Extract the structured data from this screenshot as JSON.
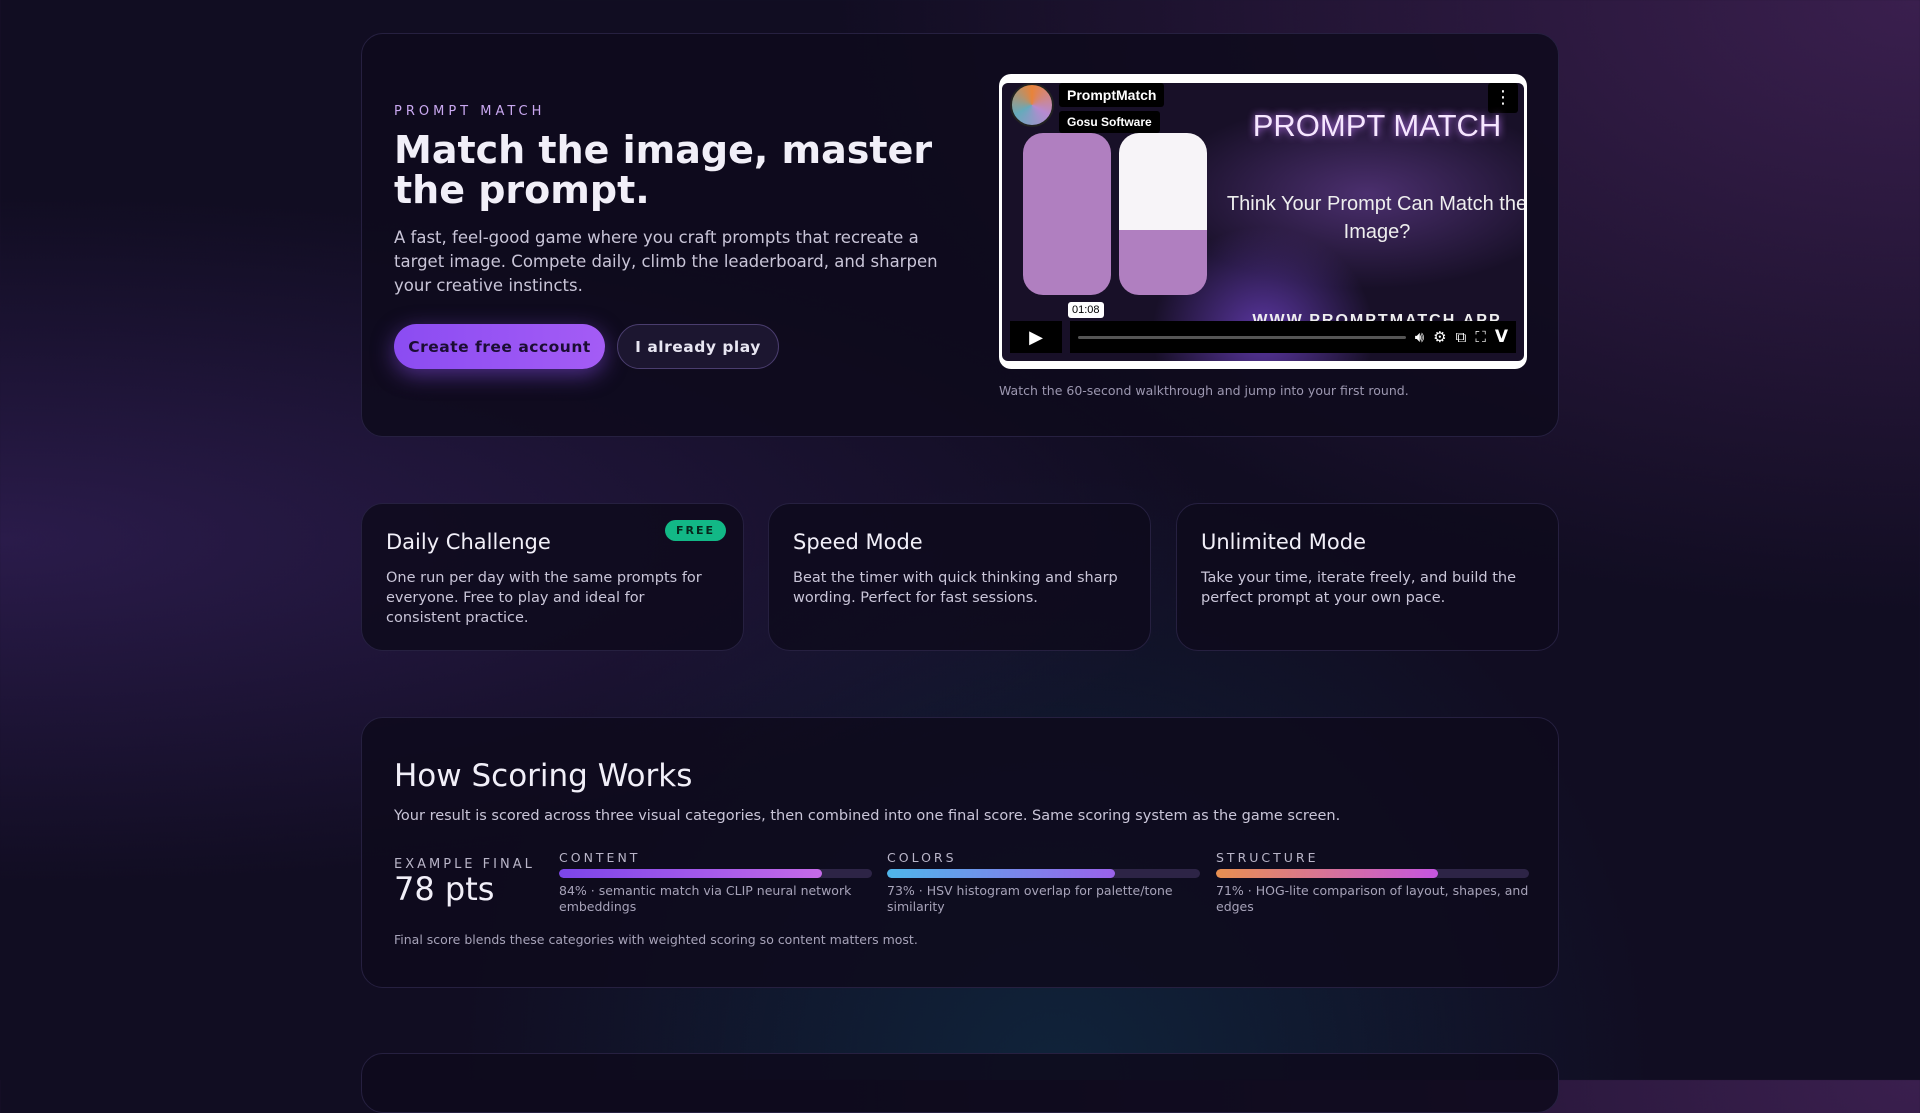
{
  "hero": {
    "eyebrow": "PROMPT MATCH",
    "title": "Match the image, master the prompt.",
    "lead": "A fast, feel-good game where you craft prompts that recreate a target image. Compete daily, climb the leaderboard, and sharpen your creative instincts.",
    "primary_button": "Create free account",
    "secondary_button": "I already play",
    "video": {
      "channel": "PromptMatch",
      "author": "Gosu Software",
      "title": "PROMPT MATCH",
      "subtitle": "Think Your Prompt Can Match the Image?",
      "url": "WWW.PROMPTMATCH.APP",
      "time": "01:08",
      "progress": 0
    },
    "caption": "Watch the 60-second walkthrough and jump into your first round."
  },
  "modes": [
    {
      "title": "Daily Challenge",
      "badge": "FREE",
      "text": "One run per day with the same prompts for everyone. Free to play and ideal for consistent practice."
    },
    {
      "title": "Speed Mode",
      "text": "Beat the timer with quick thinking and sharp wording. Perfect for fast sessions."
    },
    {
      "title": "Unlimited Mode",
      "text": "Take your time, iterate freely, and build the perfect prompt at your own pace."
    }
  ],
  "scoring": {
    "title": "How Scoring Works",
    "subtitle": "Your result is scored across three visual categories, then combined into one final score. Same scoring system as the game screen.",
    "example_label": "EXAMPLE FINAL",
    "example_value": "78 pts",
    "categories": [
      {
        "label": "CONTENT",
        "percent": 84,
        "desc": "84% · semantic match via CLIP neural network embeddings",
        "gradient": [
          "#7b45ea",
          "#c56ae8"
        ]
      },
      {
        "label": "COLORS",
        "percent": 73,
        "desc": "73% · HSV histogram overlap for palette/tone similarity",
        "gradient": [
          "#4fb6ea",
          "#9a62ea"
        ]
      },
      {
        "label": "STRUCTURE",
        "percent": 71,
        "desc": "71% · HOG-lite comparison of layout, shapes, and edges",
        "gradient": [
          "#e89050",
          "#c555e0"
        ]
      }
    ],
    "footer": "Final score blends these categories with weighted scoring so content matters most."
  }
}
